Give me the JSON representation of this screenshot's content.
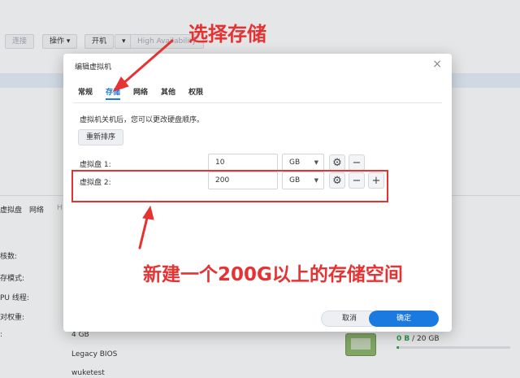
{
  "background": {
    "toolbar": {
      "connect": "连接",
      "action": "操作 ▾",
      "power_on": "开机",
      "power_more": "▾",
      "high_availability": "High Availability"
    },
    "tabs": [
      "虚拟盘",
      "网络",
      "H"
    ],
    "labels": [
      "核数:",
      "存模式:",
      "PU 线程:",
      "对权重:",
      ":"
    ],
    "values": {
      "memory": "4 GB",
      "firmware": "Legacy BIOS",
      "host": "wuketest"
    },
    "storage": {
      "used": "0 B",
      "separator": " / ",
      "total": "20 GB",
      "used_fraction": 0.02
    }
  },
  "dialog": {
    "title": "编辑虚拟机",
    "close": "×",
    "tabs": [
      {
        "label": "常规",
        "active": false
      },
      {
        "label": "存储",
        "active": true
      },
      {
        "label": "网络",
        "active": false
      },
      {
        "label": "其他",
        "active": false
      },
      {
        "label": "权限",
        "active": false
      }
    ],
    "note": "虚拟机关机后，您可以更改硬盘顺序。",
    "reorder": "重新排序",
    "disks": [
      {
        "label": "虚拟盘 1:",
        "size": "10",
        "unit": "GB"
      },
      {
        "label": "虚拟盘 2:",
        "size": "200",
        "unit": "GB"
      }
    ],
    "cancel": "取消",
    "ok": "确定"
  },
  "annotations": {
    "top": "选择存储",
    "bottom": "新建一个200G以上的存储空间",
    "color": "#e53333"
  },
  "colors": {
    "accent": "#1a7ae0",
    "annotation": "#e53333",
    "storage_used": "#2aa84a"
  }
}
